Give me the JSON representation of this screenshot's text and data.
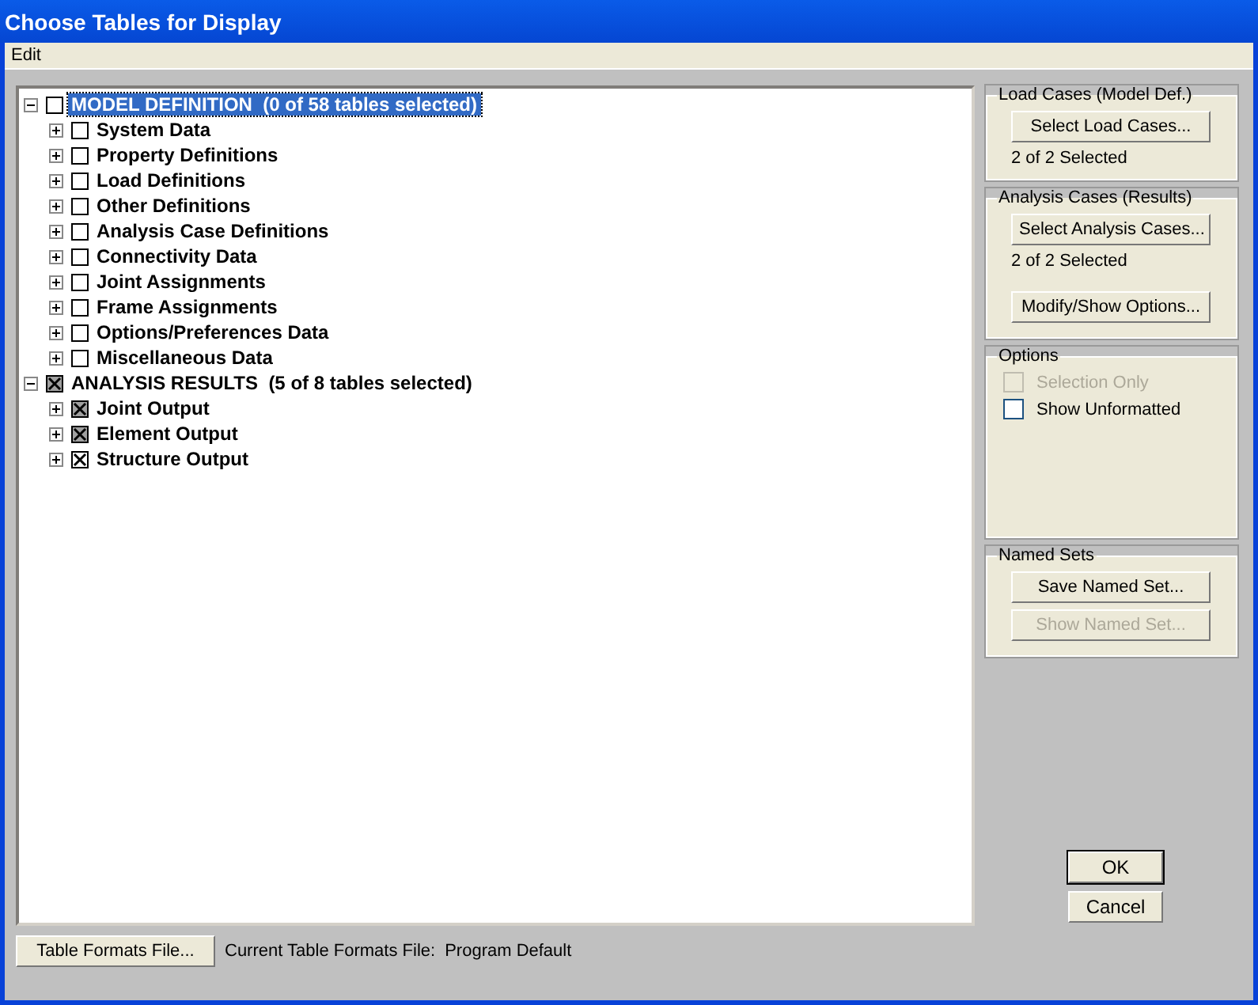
{
  "window": {
    "title": "Choose Tables for Display"
  },
  "menu": [
    "Edit"
  ],
  "tree": [
    {
      "label": "MODEL DEFINITION  (0 of 58 tables selected)",
      "selected": true,
      "expanded": true,
      "checked": false,
      "partial": false,
      "children": [
        {
          "label": "System Data",
          "selected": false,
          "expanded": false,
          "checked": false,
          "partial": false
        },
        {
          "label": "Property Definitions",
          "selected": false,
          "expanded": false,
          "checked": false,
          "partial": false
        },
        {
          "label": "Load Definitions",
          "selected": false,
          "expanded": false,
          "checked": false,
          "partial": false
        },
        {
          "label": "Other Definitions",
          "selected": false,
          "expanded": false,
          "checked": false,
          "partial": false
        },
        {
          "label": "Analysis Case Definitions",
          "selected": false,
          "expanded": false,
          "checked": false,
          "partial": false
        },
        {
          "label": "Connectivity Data",
          "selected": false,
          "expanded": false,
          "checked": false,
          "partial": false
        },
        {
          "label": "Joint Assignments",
          "selected": false,
          "expanded": false,
          "checked": false,
          "partial": false
        },
        {
          "label": "Frame Assignments",
          "selected": false,
          "expanded": false,
          "checked": false,
          "partial": false
        },
        {
          "label": "Options/Preferences Data",
          "selected": false,
          "expanded": false,
          "checked": false,
          "partial": false
        },
        {
          "label": "Miscellaneous Data",
          "selected": false,
          "expanded": false,
          "checked": false,
          "partial": false
        }
      ]
    },
    {
      "label": "ANALYSIS RESULTS  (5 of 8 tables selected)",
      "selected": false,
      "expanded": true,
      "checked": true,
      "partial": true,
      "children": [
        {
          "label": "Joint Output",
          "selected": false,
          "expanded": false,
          "checked": true,
          "partial": true
        },
        {
          "label": "Element Output",
          "selected": false,
          "expanded": false,
          "checked": true,
          "partial": true
        },
        {
          "label": "Structure Output",
          "selected": false,
          "expanded": false,
          "checked": true,
          "partial": false
        }
      ]
    }
  ],
  "groups": [
    {
      "title": "Load Cases (Model Def.)",
      "items": [
        {
          "kind": "button",
          "label": "Select Load Cases...",
          "disabled": false
        },
        {
          "kind": "text",
          "label": "2 of 2 Selected"
        }
      ]
    },
    {
      "title": "Analysis Cases (Results)",
      "items": [
        {
          "kind": "button",
          "label": "Select Analysis Cases...",
          "disabled": false
        },
        {
          "kind": "text",
          "label": "2 of 2 Selected"
        },
        {
          "kind": "button",
          "label": "Modify/Show Options...",
          "disabled": false
        }
      ]
    },
    {
      "title": "Options",
      "items": [
        {
          "kind": "checkbox",
          "label": "Selection Only",
          "checked": false,
          "disabled": true
        },
        {
          "kind": "checkbox",
          "label": "Show Unformatted",
          "checked": false,
          "disabled": false
        }
      ]
    },
    {
      "title": "Named Sets",
      "items": [
        {
          "kind": "button",
          "label": "Save Named Set...",
          "disabled": false
        },
        {
          "kind": "button",
          "label": "Show Named Set...",
          "disabled": true
        }
      ]
    }
  ],
  "footer": {
    "button": "Table Formats File...",
    "label": "Current Table Formats File:",
    "value": "Program Default"
  },
  "buttons": [
    {
      "label": "OK",
      "default": true
    },
    {
      "label": "Cancel",
      "default": false
    }
  ]
}
